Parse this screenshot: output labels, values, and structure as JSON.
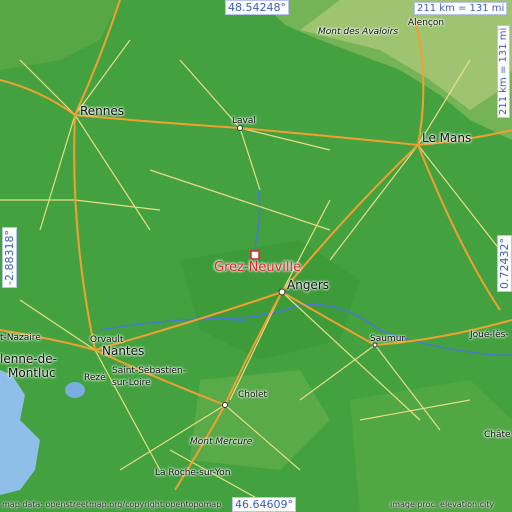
{
  "map": {
    "place_name": "Grez-Neuville",
    "coords": {
      "top_lat": "48.54248°",
      "bottom_lat": "46.64609°",
      "left_lon": "-2.88318°",
      "right_lon": "0.72432°"
    },
    "scale": {
      "horizontal": "211 km = 131 mi",
      "vertical": "211 km = 131 mi"
    },
    "attribution": {
      "left": "map data: openstreetmap.org/copyright",
      "left_suffix": "opentopomap",
      "right": "image proc. elevation.city"
    },
    "cities": {
      "rennes": "Rennes",
      "laval": "Laval",
      "le_mans": "Le Mans",
      "alencon": "Alençon",
      "mont_avaloirs": "Mont des Avaloirs",
      "angers": "Angers",
      "saumur": "Saumur",
      "joue": "Joué-lès-",
      "nantes": "Nantes",
      "orvault": "Orvault",
      "saint_nazaire": "t-Nazaire",
      "blain": "lenne-de-",
      "montluc": "Montluc",
      "reze": "Rezé",
      "saint_sebastien_1": "Saint-Sébastien-",
      "saint_sebastien_2": "sur-Loire",
      "cholet": "Cholet",
      "mont_mercure": "Mont Mercure",
      "roche_sur_yon": "La Roche-sur-Yon",
      "chate": "Châte"
    },
    "colors": {
      "base_green": "#3f9e3c",
      "marker": "#e2242f",
      "coord_text": "#3a5dbb",
      "roads_major": "#f0a030",
      "roads_minor": "#f2e08a",
      "water": "#4a78d0"
    }
  }
}
